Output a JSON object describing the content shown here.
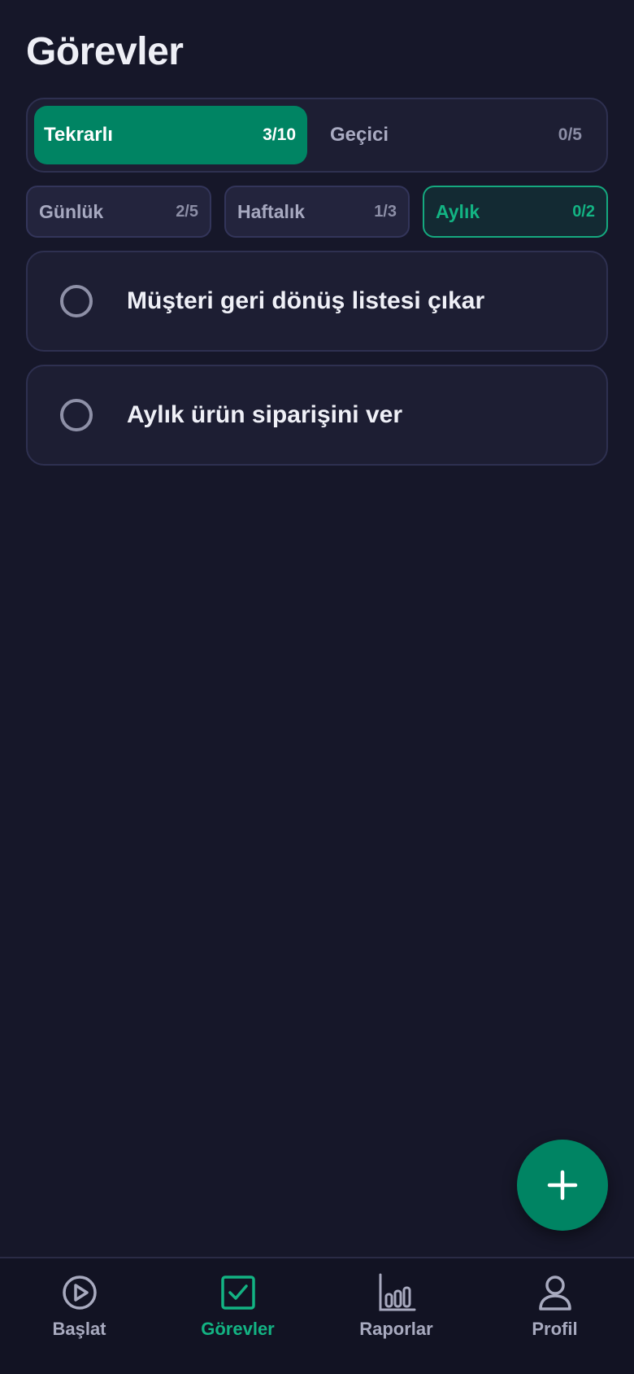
{
  "page": {
    "title": "Görevler"
  },
  "segments": [
    {
      "label": "Tekrarlı",
      "count": "3/10",
      "active": true
    },
    {
      "label": "Geçici",
      "count": "0/5",
      "active": false
    }
  ],
  "filters": [
    {
      "label": "Günlük",
      "count": "2/5",
      "active": false
    },
    {
      "label": "Haftalık",
      "count": "1/3",
      "active": false
    },
    {
      "label": "Aylık",
      "count": "0/2",
      "active": true
    }
  ],
  "tasks": [
    {
      "text": "Müşteri geri dönüş listesi çıkar",
      "done": false
    },
    {
      "text": "Aylık ürün siparişini ver",
      "done": false
    }
  ],
  "fab": {
    "icon": "plus-icon"
  },
  "nav": [
    {
      "label": "Başlat",
      "icon": "play-circle-icon",
      "active": false
    },
    {
      "label": "Görevler",
      "icon": "checkbox-icon",
      "active": true
    },
    {
      "label": "Raporlar",
      "icon": "bar-chart-icon",
      "active": false
    },
    {
      "label": "Profil",
      "icon": "user-icon",
      "active": false
    }
  ],
  "colors": {
    "background": "#161729",
    "accent": "#008463",
    "accent_text": "#13B383",
    "card": "#1D1E33"
  }
}
